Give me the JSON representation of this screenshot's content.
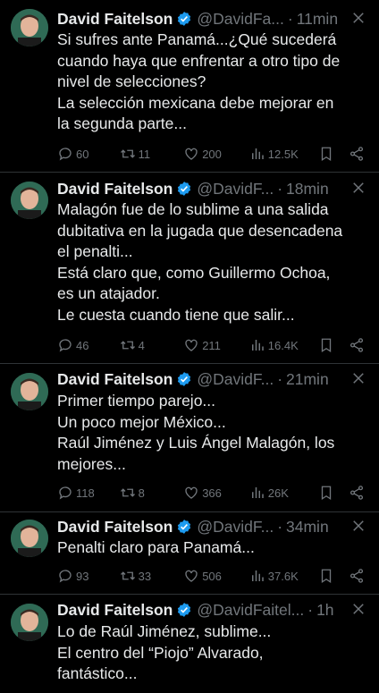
{
  "colors": {
    "background": "#000000",
    "text": "#e7e9ea",
    "muted": "#71767b",
    "verified": "#1d9bf0"
  },
  "icons": {
    "verified": "verified-badge-icon",
    "more": "more-options-icon",
    "reply": "reply-icon",
    "retweet": "retweet-icon",
    "like": "like-icon",
    "views": "views-icon",
    "bookmark": "bookmark-icon",
    "share": "share-icon"
  },
  "tweets": [
    {
      "name": "David Faitelson",
      "handle": "@DavidFa...",
      "separator": "·",
      "time": "11min",
      "lines": [
        "Si sufres ante Panamá...¿Qué sucederá",
        "cuando haya que enfrentar a otro tipo de",
        "nivel de selecciones?",
        "La selección mexicana debe mejorar en",
        "la segunda parte..."
      ],
      "replies": "60",
      "retweets": "11",
      "likes": "200",
      "views": "12.5K"
    },
    {
      "name": "David Faitelson",
      "handle": "@DavidF...",
      "separator": "·",
      "time": "18min",
      "lines": [
        "Malagón fue de lo sublime a una salida",
        "dubitativa en la jugada que desencadena",
        "el penalti...",
        "Está claro que, como Guillermo Ochoa,",
        "es un atajador.",
        "Le cuesta cuando tiene que salir..."
      ],
      "replies": "46",
      "retweets": "4",
      "likes": "211",
      "views": "16.4K"
    },
    {
      "name": "David Faitelson",
      "handle": "@DavidF...",
      "separator": "·",
      "time": "21min",
      "lines": [
        "Primer tiempo parejo...",
        "Un poco mejor México...",
        "Raúl Jiménez y Luis Ángel Malagón, los",
        "mejores..."
      ],
      "replies": "118",
      "retweets": "8",
      "likes": "366",
      "views": "26K"
    },
    {
      "name": "David Faitelson",
      "handle": "@DavidF...",
      "separator": "·",
      "time": "34min",
      "lines": [
        "Penalti claro para Panamá..."
      ],
      "replies": "93",
      "retweets": "33",
      "likes": "506",
      "views": "37.6K"
    },
    {
      "name": "David Faitelson",
      "handle": "@DavidFaitel...",
      "separator": "·",
      "time": "1h",
      "lines": [
        "Lo de Raúl Jiménez, sublime...",
        "El centro del “Piojo” Alvarado,",
        "fantástico..."
      ]
    }
  ]
}
